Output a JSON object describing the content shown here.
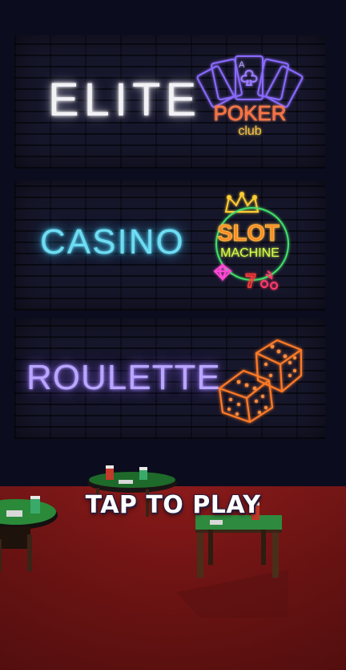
{
  "signs": {
    "elite": "ELITE",
    "casino": "CASINO",
    "roulette": "ROULETTE",
    "poker_card_letter": "A",
    "poker_word": "POKER",
    "club_word": "club",
    "slot_word": "SLOT",
    "machine_word": "MACHINE",
    "seven": "7"
  },
  "prompt": {
    "tap_to_play": "TAP TO PLAY"
  },
  "colors": {
    "elite": "#f2f2f6",
    "casino": "#6fdcf2",
    "roulette": "#b9a6ff",
    "poker": "#ff6a3a",
    "poker_cards": "#8a6bff",
    "slot": "#ffb23a",
    "machine": "#d7ff4a",
    "dice": "#ff7a28",
    "floor": "#7d1616"
  }
}
